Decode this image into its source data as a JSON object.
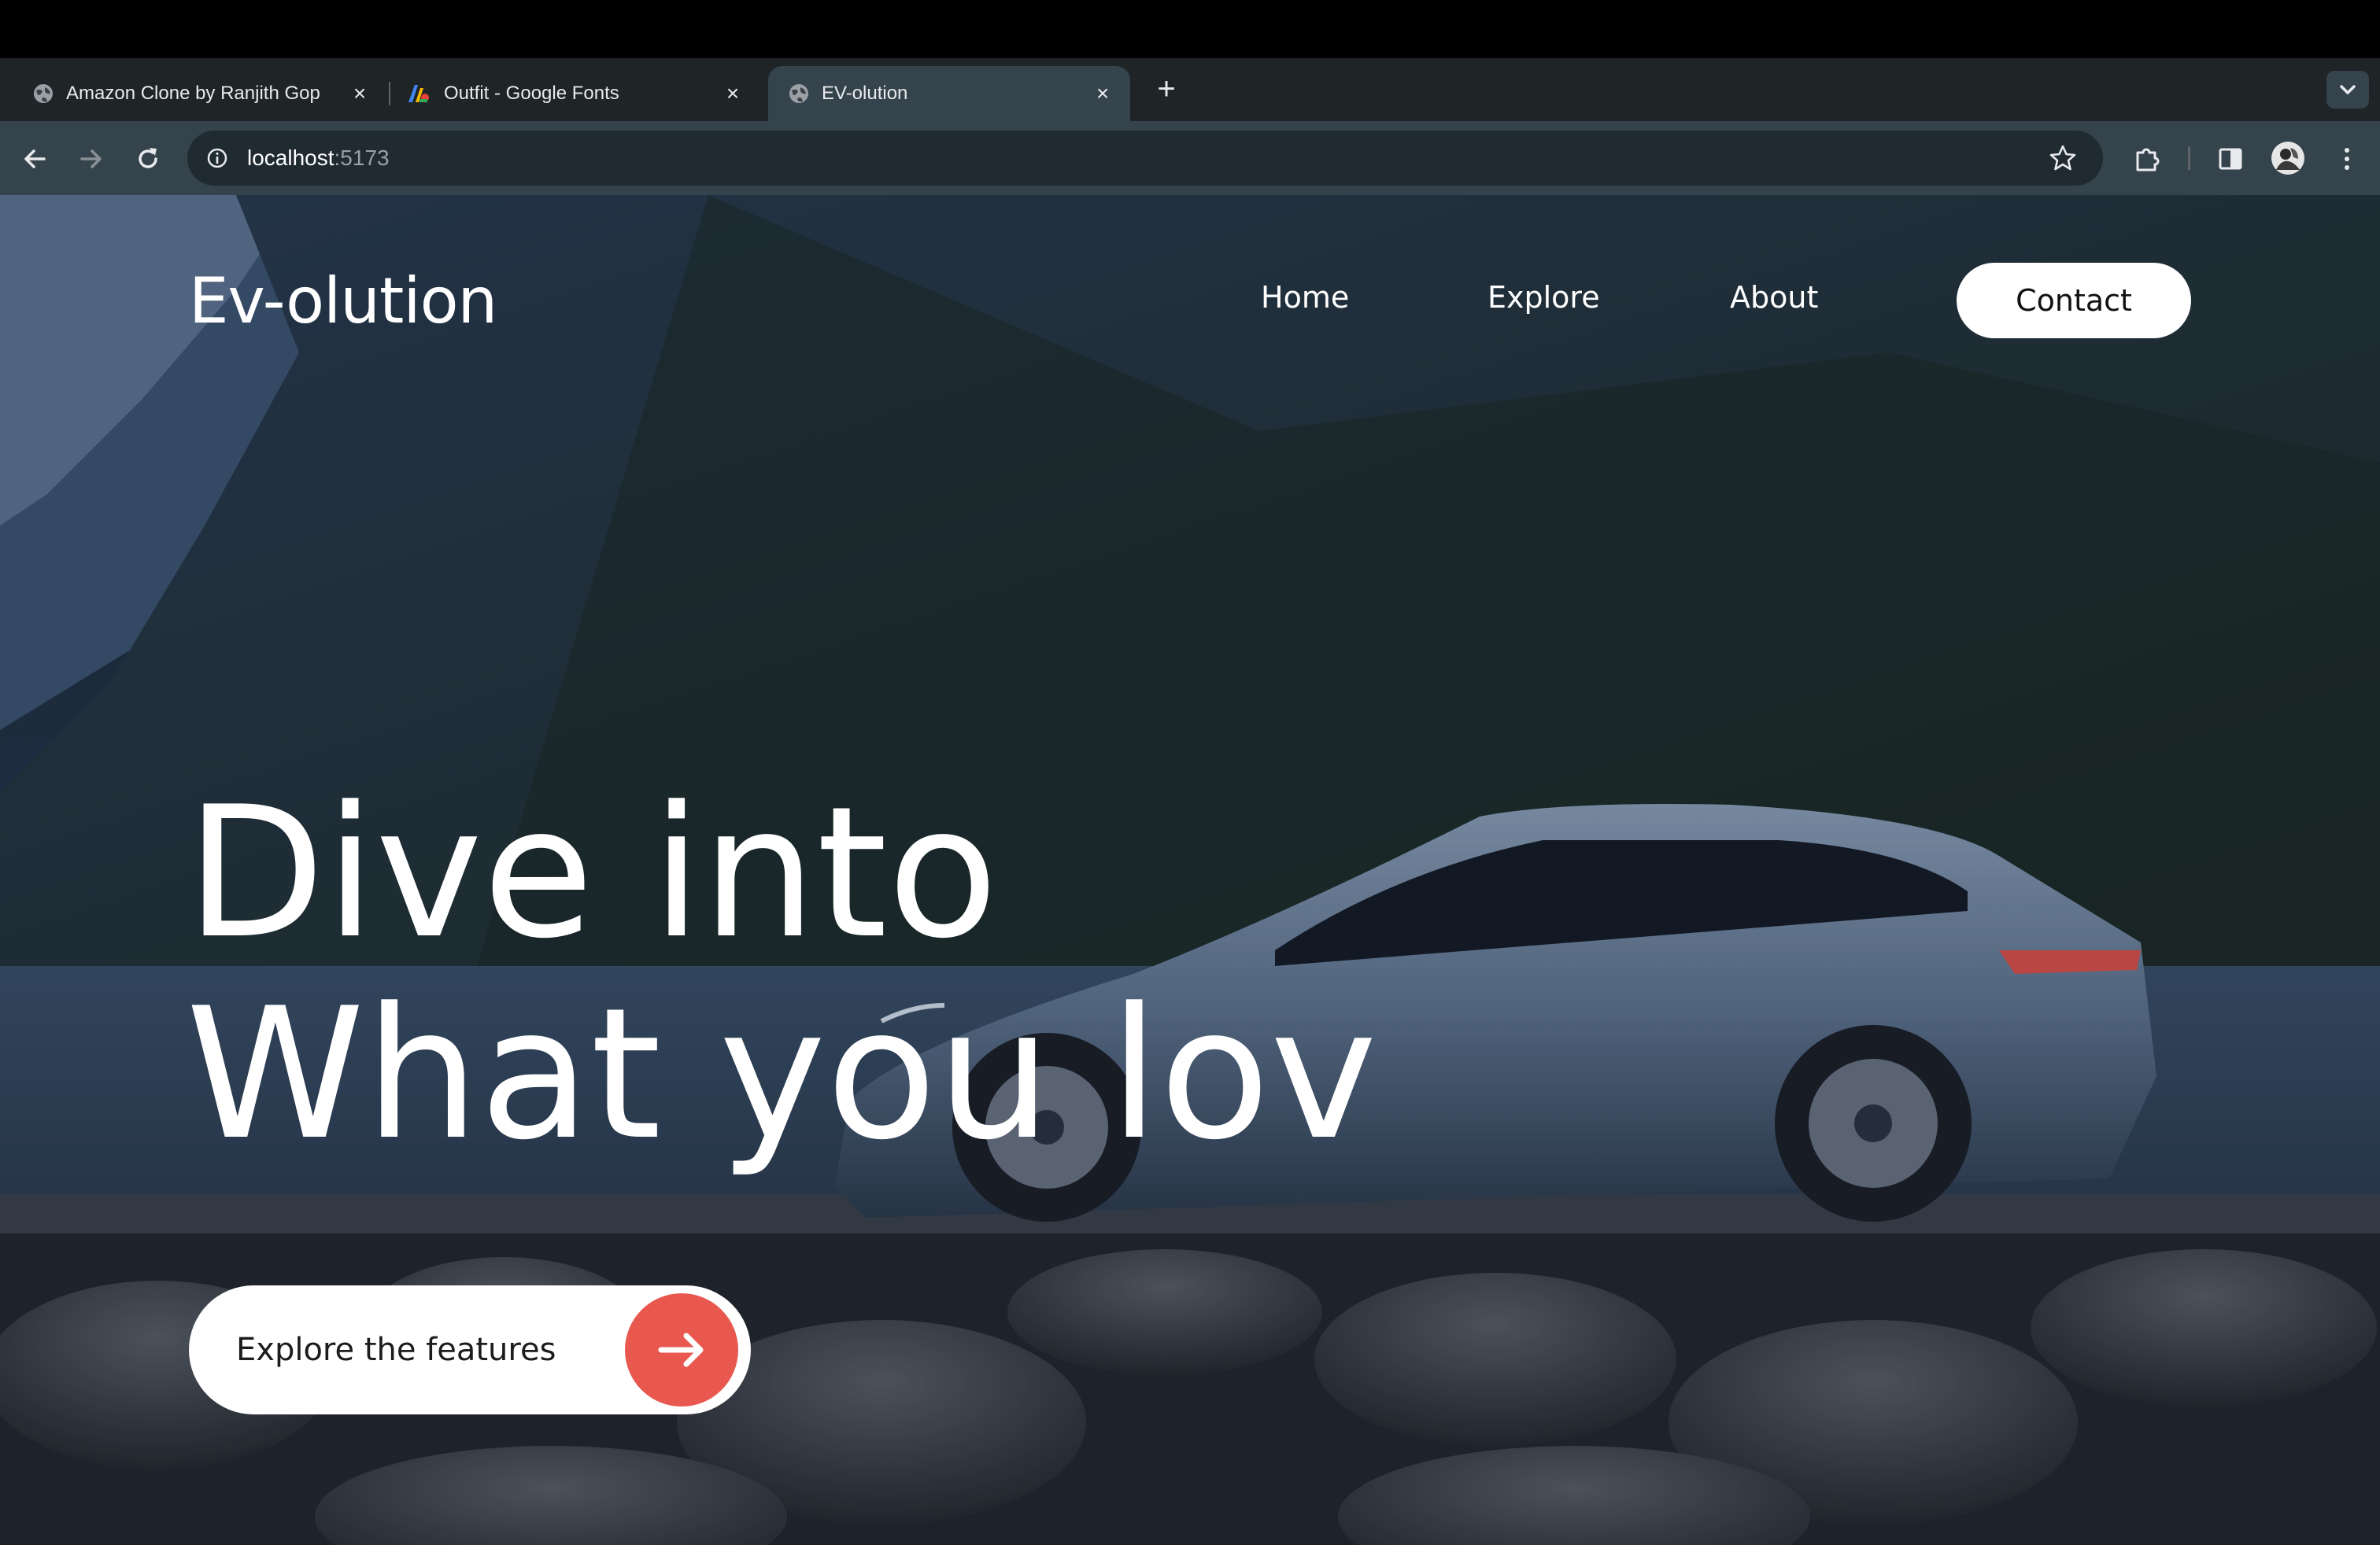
{
  "browser": {
    "tabs": [
      {
        "title": "Amazon Clone by Ranjith Gop",
        "active": false,
        "favicon": "globe-icon"
      },
      {
        "title": "Outfit - Google Fonts",
        "active": false,
        "favicon": "google-fonts-icon"
      },
      {
        "title": "EV-olution",
        "active": true,
        "favicon": "globe-icon"
      }
    ],
    "address": {
      "host": "localhost",
      "port": ":5173"
    }
  },
  "site": {
    "logo": "Ev-olution",
    "nav": {
      "home": "Home",
      "explore": "Explore",
      "about": "About",
      "contact": "Contact"
    },
    "hero": {
      "line1": "Dive into",
      "line2": "What you lov",
      "cta_label": "Explore the features"
    }
  },
  "colors": {
    "accent": "#e8584f",
    "toolbar": "#35434d",
    "tabstrip": "#1f2427"
  }
}
